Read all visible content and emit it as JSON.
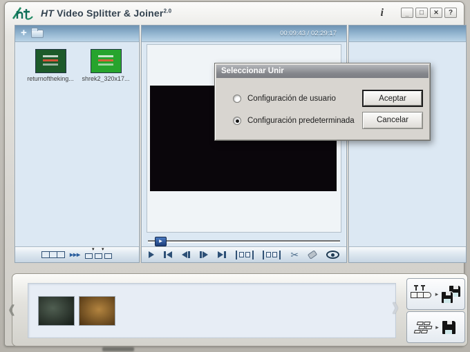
{
  "window": {
    "title_em": "HT",
    "title": "Video Splitter & Joiner",
    "version": "2.0",
    "info_glyph": "i",
    "controls": {
      "minimize": "_",
      "maximize": "□",
      "close": "✕",
      "help": "?"
    }
  },
  "left_panel": {
    "add_glyph": "+",
    "clips": [
      {
        "name": "returnoftheking...",
        "color": "#1d5a2a"
      },
      {
        "name": "shrek2_320x17...",
        "color": "#27a42d"
      }
    ],
    "footer_icons": [
      "filmstrip-icon",
      "fast-forward-icon",
      "split-markers-icon"
    ],
    "fast_glyph": "▸▸▸",
    "marker_glyph": "▾"
  },
  "center_panel": {
    "timecode": "00:09:43 / 02:29:17",
    "handle_glyph": "▶",
    "cut_glyph": "✂",
    "transport_icons": [
      "play-icon",
      "go-start-icon",
      "step-back-icon",
      "step-forward-icon",
      "go-end-icon",
      "mark-in-icon",
      "mark-out-icon",
      "cut-icon",
      "erase-icon",
      "preview-eye-icon"
    ]
  },
  "tray": {
    "prev_glyph": "‹",
    "next_glyph": "›",
    "arrow_glyph": "▸",
    "thumbs": [
      {
        "color": "#2e3b30"
      },
      {
        "color": "#8a5a20"
      }
    ],
    "buttons": [
      "save-split-segments",
      "save-joined-file"
    ]
  },
  "dialog": {
    "title": "Seleccionar Unir",
    "options": [
      {
        "label": "Configuración de usuario",
        "selected": false
      },
      {
        "label": "Configuración predeterminada",
        "selected": true
      }
    ],
    "accept_label": "Aceptar",
    "cancel_label": "Cancelar"
  }
}
